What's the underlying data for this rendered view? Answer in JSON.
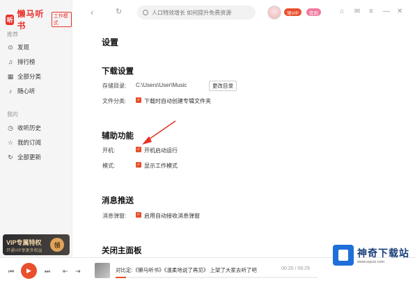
{
  "app": {
    "logo_mark": "听",
    "logo_text": "懒马听书",
    "logo_badge": "工作模式"
  },
  "sidebar": {
    "group1_title": "推荐",
    "items1": [
      {
        "label": "发现",
        "icon": "compass-icon"
      },
      {
        "label": "排行榜",
        "icon": "ranking-icon"
      },
      {
        "label": "全部分类",
        "icon": "grid-icon"
      },
      {
        "label": "随心听",
        "icon": "radio-icon"
      }
    ],
    "group2_title": "我的",
    "items2": [
      {
        "label": "收听历史",
        "icon": "clock-icon"
      },
      {
        "label": "我的订阅",
        "icon": "star-icon"
      },
      {
        "label": "全部更新",
        "icon": "refresh-icon"
      }
    ],
    "vip": {
      "title": "VIP专属特权",
      "subtitle": "开通VIP享更多权益",
      "button": "领"
    }
  },
  "topbar": {
    "search_placeholder": "人口特效增长 如何提升免费资源",
    "badge1": "领VIP",
    "badge2": "签到"
  },
  "settings": {
    "page_title": "设置",
    "download": {
      "title": "下载设置",
      "dir_label": "存储目录:",
      "dir_value": "C:\\Users\\User\\Music",
      "change_btn": "更改目录",
      "category_label": "文件分类:",
      "category_option": "下载时自动创建专辑文件夹"
    },
    "accessibility": {
      "title": "辅助功能",
      "startup_label": "开机:",
      "startup_option": "开机启动运行",
      "mode_label": "模式:",
      "mode_option": "显示工作模式"
    },
    "push": {
      "title": "消息推送",
      "label": "消息弹窗:",
      "option": "启用自动接收消息弹窗"
    },
    "close": {
      "title": "关闭主面板"
    }
  },
  "player": {
    "track": "对比定:《懒马听书》《温柔地说了再见》 上架了大家去听了吧",
    "time": "00:20 / 06:29",
    "progress": 0.05
  },
  "watermark": {
    "title": "神奇下载站",
    "url": "www.sqxzz.com"
  },
  "colors": {
    "accent": "#e8502d",
    "brand": "#e8322d"
  }
}
